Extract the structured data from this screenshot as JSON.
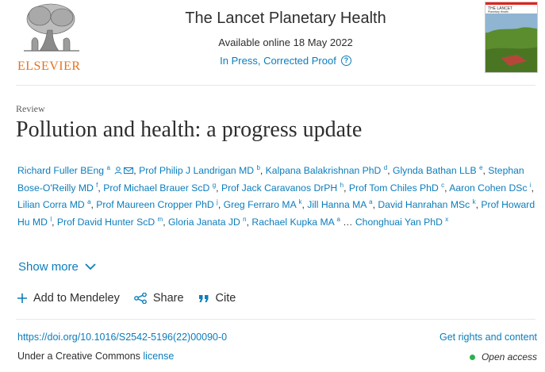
{
  "header": {
    "publisher": "ELSEVIER",
    "journal_title": "The Lancet Planetary Health",
    "available": "Available online 18 May 2022",
    "status": "In Press, Corrected Proof",
    "help_icon": "?",
    "cover_title": "THE LANCET",
    "cover_subtitle": "Planetary Health"
  },
  "article": {
    "type": "Review",
    "title": "Pollution and health: a progress update"
  },
  "authors": [
    {
      "name": "Richard Fuller BEng",
      "sup": "a"
    },
    {
      "name": "Prof Philip J Landrigan MD",
      "sup": "b"
    },
    {
      "name": "Kalpana Balakrishnan PhD",
      "sup": "d"
    },
    {
      "name": "Glynda Bathan LLB",
      "sup": "e"
    },
    {
      "name": "Stephan Bose-O'Reilly MD",
      "sup": "f"
    },
    {
      "name": "Prof Michael Brauer ScD",
      "sup": "g"
    },
    {
      "name": "Prof Jack Caravanos DrPH",
      "sup": "h"
    },
    {
      "name": "Prof Tom Chiles PhD",
      "sup": "c"
    },
    {
      "name": "Aaron Cohen DSc",
      "sup": "i"
    },
    {
      "name": "Lilian Corra MD",
      "sup": "a"
    },
    {
      "name": "Prof Maureen Cropper PhD",
      "sup": "j"
    },
    {
      "name": "Greg Ferraro MA",
      "sup": "k"
    },
    {
      "name": "Jill Hanna MA",
      "sup": "a"
    },
    {
      "name": "David Hanrahan MSc",
      "sup": "k"
    },
    {
      "name": "Prof Howard Hu MD",
      "sup": "l"
    },
    {
      "name": "Prof David Hunter ScD",
      "sup": "m"
    },
    {
      "name": "Gloria Janata JD",
      "sup": "n"
    },
    {
      "name": "Rachael Kupka MA",
      "sup": "a"
    },
    {
      "name": "Chonghuai Yan PhD",
      "sup": "x"
    }
  ],
  "ellipsis": "…",
  "show_more": "Show more",
  "actions": {
    "mendeley": "Add to Mendeley",
    "share": "Share",
    "cite": "Cite"
  },
  "doi": "https://doi.org/10.1016/S2542-5196(22)00090-0",
  "rights": "Get rights and content",
  "license": {
    "prefix": "Under a Creative Commons",
    "link": "license"
  },
  "open_access": "Open access",
  "colors": {
    "link": "#0c7dbb",
    "elsevier_orange": "#e9711c",
    "open_access_dot": "#2bb24c"
  }
}
